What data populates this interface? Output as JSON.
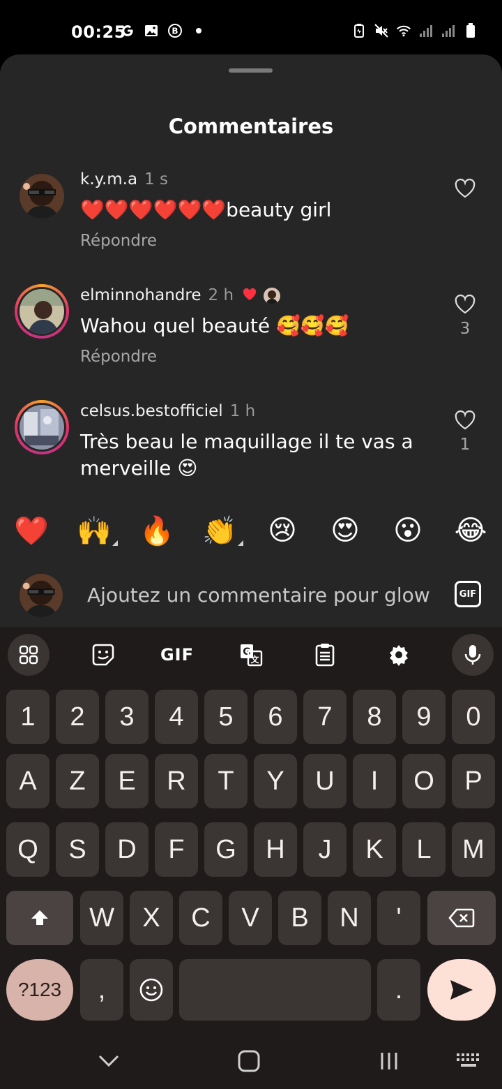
{
  "status_bar": {
    "time": "00:25",
    "left_icons": [
      "google-g-icon",
      "gallery-icon",
      "b-badge-icon",
      "dot-icon"
    ],
    "right_icons": [
      "battery-saver-icon",
      "mute-icon",
      "wifi-icon",
      "signal-icon",
      "signal-icon",
      "battery-icon"
    ]
  },
  "sheet": {
    "title": "Commentaires"
  },
  "comments": [
    {
      "username": "k.y.m.a",
      "time": "1 s",
      "text": "❤️❤️❤️❤️❤️❤️beauty girl",
      "reply_label": "Répondre",
      "likes": ""
    },
    {
      "username": "elminnohandre",
      "time": "2 h",
      "text": "Wahou quel beauté 🥰🥰🥰",
      "reply_label": "Répondre",
      "likes": "3"
    },
    {
      "username": "celsus.bestofficiel",
      "time": "1 h",
      "text": "Très beau le maquillage il te vas a merveille 😍",
      "reply_label": "Répondre",
      "likes": "1"
    }
  ],
  "reactions": [
    "❤️",
    "🙌",
    "🔥",
    "👏",
    "😢",
    "😍",
    "😮",
    "😂"
  ],
  "input": {
    "placeholder": "Ajoutez un commentaire pour glow",
    "gif_label": "GIF"
  },
  "keyboard": {
    "toolbar": {
      "gif_label": "GIF"
    },
    "row_numbers": [
      "1",
      "2",
      "3",
      "4",
      "5",
      "6",
      "7",
      "8",
      "9",
      "0"
    ],
    "row1": [
      "A",
      "Z",
      "E",
      "R",
      "T",
      "Y",
      "U",
      "I",
      "O",
      "P"
    ],
    "row2": [
      "Q",
      "S",
      "D",
      "F",
      "G",
      "H",
      "J",
      "K",
      "L",
      "M"
    ],
    "row3": [
      "W",
      "X",
      "C",
      "V",
      "B",
      "N",
      "'"
    ],
    "symbols_label": "?123",
    "comma_label": ",",
    "period_label": "."
  },
  "colors": {
    "sheet_bg": "#262626",
    "keyboard_bg": "#1f1b1a",
    "key_bg": "#3b3534",
    "accent_heart": "#ff3040",
    "symbols_key": "#d7b3a9",
    "send_key": "#fde0d6"
  }
}
